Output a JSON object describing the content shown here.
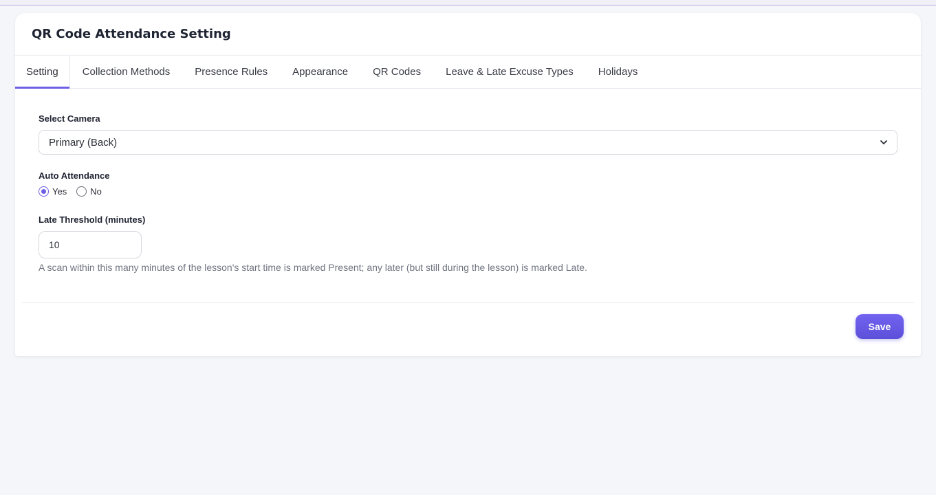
{
  "page": {
    "title": "QR Code Attendance Setting"
  },
  "tabs": [
    {
      "label": "Setting",
      "active": true
    },
    {
      "label": "Collection Methods",
      "active": false
    },
    {
      "label": "Presence Rules",
      "active": false
    },
    {
      "label": "Appearance",
      "active": false
    },
    {
      "label": "QR Codes",
      "active": false
    },
    {
      "label": "Leave & Late Excuse Types",
      "active": false
    },
    {
      "label": "Holidays",
      "active": false
    }
  ],
  "camera": {
    "label": "Select Camera",
    "value": "Primary (Back)"
  },
  "auto_attendance": {
    "label": "Auto Attendance",
    "options": [
      {
        "label": "Yes",
        "checked": true
      },
      {
        "label": "No",
        "checked": false
      }
    ]
  },
  "late_threshold": {
    "label": "Late Threshold (minutes)",
    "value": "10",
    "help": "A scan within this many minutes of the lesson's start time is marked Present; any later (but still during the lesson) is marked Late."
  },
  "actions": {
    "save_label": "Save"
  },
  "colors": {
    "accent": "#6d5fe6",
    "background": "#f5f6fa"
  }
}
